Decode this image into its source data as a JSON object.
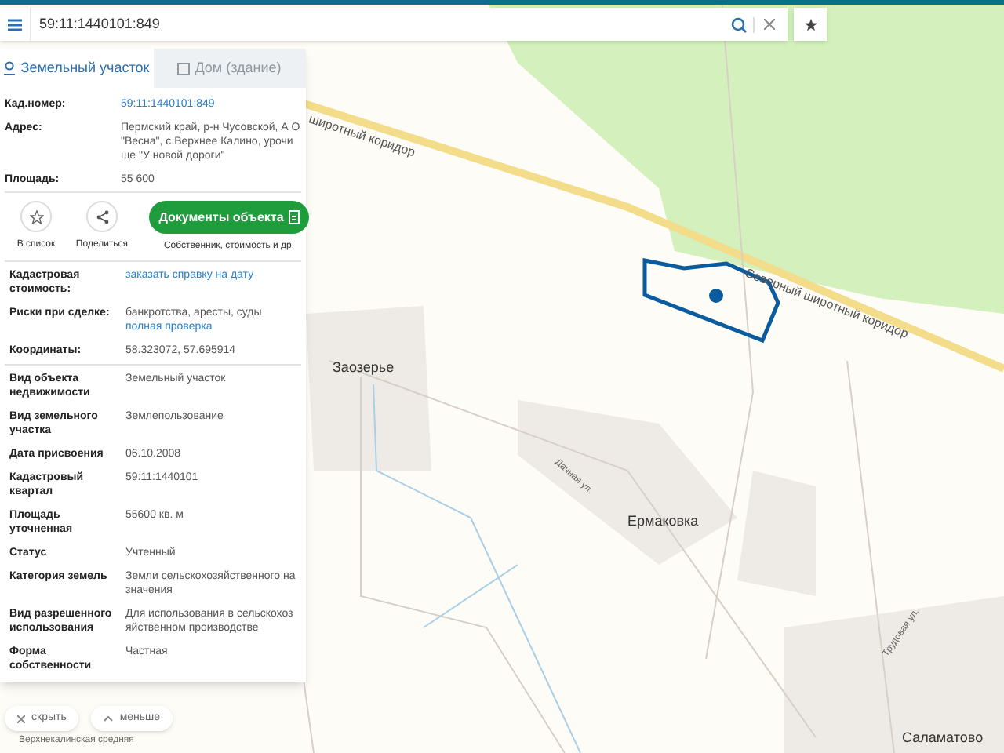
{
  "search": {
    "value": "59:11:1440101:849"
  },
  "panel": {
    "tabs": [
      {
        "label": "Земельный участок",
        "selected": true
      },
      {
        "label": "Дом (здание)",
        "selected": false
      }
    ],
    "summary": [
      {
        "label": "Кад.номер:",
        "link": "59:11:1440101:849"
      },
      {
        "label": "Адрес:",
        "value": "Пермский край, р-н Чусовской, А О \"Весна\", с.Верхнее Калино, урочище \"У новой дороги\""
      },
      {
        "label": "Площадь:",
        "value": "55 600"
      }
    ],
    "actions": [
      {
        "label": "В список",
        "kind": "star"
      },
      {
        "label": "Поделиться",
        "kind": "share"
      }
    ],
    "documents": {
      "label": "Документы объекта",
      "caption": "Собственник, стоимость и др."
    },
    "sections": [
      [
        {
          "label": "Кадастровая стоимость:",
          "link": "заказать справку на дату"
        },
        {
          "label": "Риски при сделке:",
          "value": "банкротства, аресты, суды",
          "link": "полная проверка"
        },
        {
          "label": "Координаты:",
          "value": "58.323072, 57.695914"
        }
      ],
      [
        {
          "label": "Вид объекта недвижимости",
          "value": "Земельный участок"
        },
        {
          "label": "Вид земельного участка",
          "value": "Землепользование"
        },
        {
          "label": "Дата присвоения",
          "value": "06.10.2008"
        },
        {
          "label": "Кадастровый квартал",
          "value": "59:11:1440101"
        },
        {
          "label": "Площадь уточненная",
          "value": "55600 кв. м"
        },
        {
          "label": "Статус",
          "value": "Учтенный"
        },
        {
          "label": "Категория земель",
          "value": "Земли сельскохозяйственного назначения"
        },
        {
          "label": "Вид разрешенного использования",
          "value": "Для использования в сельскохозяйственном производстве"
        },
        {
          "label": "Форма собственности",
          "value": "Частная"
        }
      ]
    ]
  },
  "bottom_buttons": [
    {
      "label": "скрыть",
      "kind": "close"
    },
    {
      "label": "меньше",
      "kind": "up"
    }
  ],
  "map_labels": [
    {
      "text": "Северный широтный коридор",
      "kind": "road"
    },
    {
      "text": "широтный коридор",
      "kind": "road"
    },
    {
      "text": "Заозерье",
      "kind": "place"
    },
    {
      "text": "Дачная ул.",
      "kind": "street"
    },
    {
      "text": "Ермаковка",
      "kind": "place"
    },
    {
      "text": "Саламатово",
      "kind": "place"
    },
    {
      "text": "Трудовая ул.",
      "kind": "street"
    },
    {
      "text": "Верхнекалинская средняя",
      "kind": "poi"
    }
  ]
}
